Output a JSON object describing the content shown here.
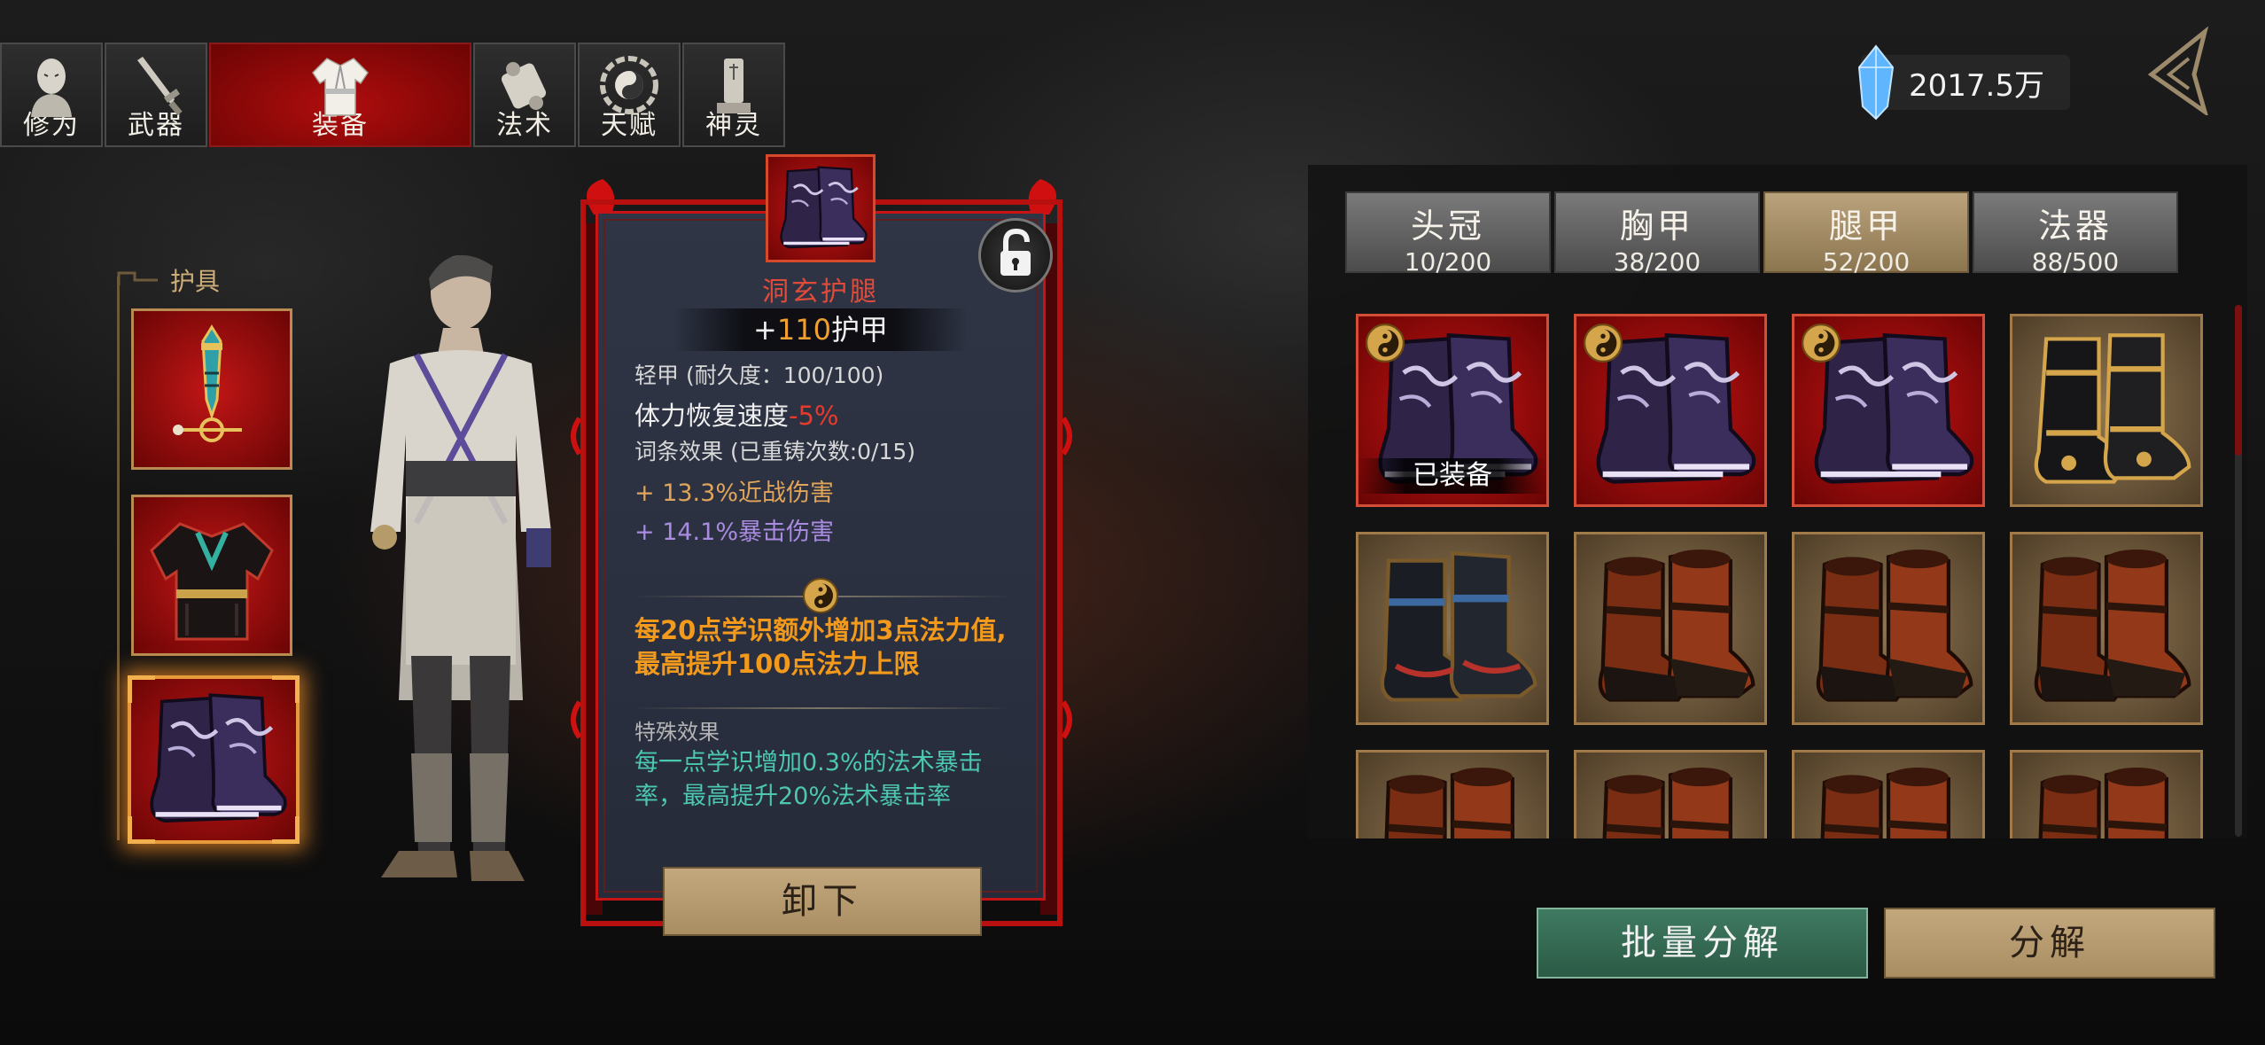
{
  "tabs": [
    {
      "label": "修为",
      "icon": "monk-head-icon"
    },
    {
      "label": "武器",
      "icon": "sword-icon"
    },
    {
      "label": "装备",
      "icon": "robe-icon",
      "active": true
    },
    {
      "label": "法术",
      "icon": "scroll-icon"
    },
    {
      "label": "天赋",
      "icon": "bagua-icon"
    },
    {
      "label": "神灵",
      "icon": "tablet-icon"
    }
  ],
  "currency": {
    "icon": "crystal-icon",
    "amount": "2017.5万"
  },
  "slots": {
    "label": "护具",
    "items": [
      {
        "name": "amulet-slot",
        "icon": "amulet-icon"
      },
      {
        "name": "chest-slot",
        "icon": "robe-armor-icon"
      },
      {
        "name": "boots-slot",
        "icon": "purple-boots-icon",
        "selected": true
      }
    ]
  },
  "detail": {
    "name": "洞玄护腿",
    "armor_prefix": "+",
    "armor_value": "110",
    "armor_suffix": "护甲",
    "durability": "轻甲 (耐久度：100/100)",
    "stamina_label": "体力恢复速度",
    "stamina_value": "-5%",
    "affix_title": "词条效果 (已重铸次数:0/15)",
    "affix1": "+ 13.3%近战伤害",
    "affix2": "+ 14.1%暴击伤害",
    "bonus": "每20点学识额外增加3点法力值,最高提升100点法力上限",
    "special_title": "特殊效果",
    "special": "每一点学识增加0.3%的法术暴击率，最高提升20%法术暴击率",
    "unequip_label": "卸下"
  },
  "categories": [
    {
      "name": "头冠",
      "count": "10/200"
    },
    {
      "name": "胸甲",
      "count": "38/200"
    },
    {
      "name": "腿甲",
      "count": "52/200",
      "active": true
    },
    {
      "name": "法器",
      "count": "88/500"
    }
  ],
  "inventory": [
    {
      "type": "purple",
      "bg": "red",
      "badge": true,
      "equipped_label": "已装备"
    },
    {
      "type": "purple",
      "bg": "red",
      "badge": true
    },
    {
      "type": "purple",
      "bg": "red",
      "badge": true
    },
    {
      "type": "black-gold",
      "bg": "gold"
    },
    {
      "type": "black-blue",
      "bg": "gold"
    },
    {
      "type": "leather",
      "bg": "gold"
    },
    {
      "type": "leather",
      "bg": "gold"
    },
    {
      "type": "leather",
      "bg": "gold"
    },
    {
      "type": "leather",
      "bg": "gold"
    },
    {
      "type": "leather",
      "bg": "gold"
    },
    {
      "type": "leather",
      "bg": "gold"
    },
    {
      "type": "leather",
      "bg": "gold"
    }
  ],
  "actions": {
    "batch_label": "批量分解",
    "dismantle_label": "分解"
  },
  "colors": {
    "accent_red": "#c81414",
    "gold": "#b78b52",
    "green_button": "#3f7a62",
    "orange_text": "#f39a1c",
    "teal_text": "#4cc7b0"
  }
}
